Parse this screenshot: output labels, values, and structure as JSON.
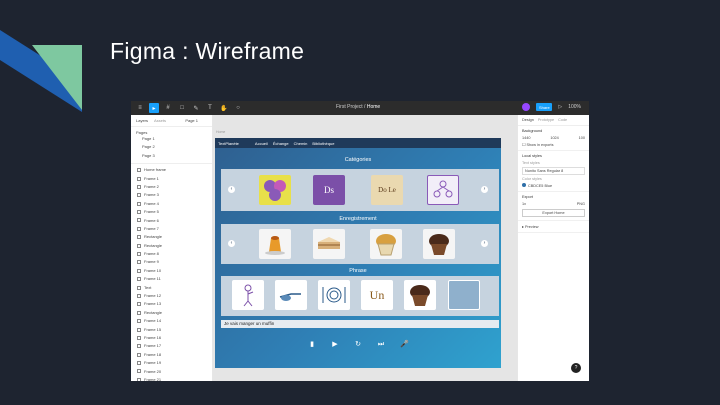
{
  "slide": {
    "title": "Figma : Wireframe",
    "accent_blue": "#1f5fb0",
    "accent_green": "#7ec8a0"
  },
  "toolbar": {
    "icons": [
      "menu-icon",
      "move-icon",
      "frame-icon",
      "shape-icon",
      "pen-icon",
      "text-icon",
      "hand-icon",
      "comment-icon"
    ],
    "project": "First Project",
    "separator": " / ",
    "file": "Home",
    "share_label": "Share",
    "play_icon": "play-icon",
    "zoom": "100%"
  },
  "left_panel": {
    "tabs": [
      "Layers",
      "Assets"
    ],
    "page_indicator": "Page 1",
    "pages_header": "Pages",
    "pages": [
      "Page 1",
      "Page 2",
      "Page 3"
    ],
    "layers": [
      "Home frame",
      "Frame 1",
      "Frame 2",
      "Frame 3",
      "Frame 4",
      "Frame 5",
      "Frame 6",
      "Frame 7",
      "Rectangle",
      "Rectangle",
      "Frame 8",
      "Frame 9",
      "Frame 10",
      "Frame 11",
      "Text",
      "Frame 12",
      "Frame 13",
      "Rectangle",
      "Frame 14",
      "Frame 15",
      "Frame 16",
      "Frame 17",
      "Frame 18",
      "Frame 19",
      "Frame 20",
      "Frame 21",
      "Frame 22",
      "Frame 23"
    ]
  },
  "canvas": {
    "frame_label": "Home",
    "navbar": {
      "brand": "TextPlanète",
      "items": [
        "Accueil",
        "Échange",
        "Chemin",
        "Bibliothèque"
      ]
    },
    "sections": [
      {
        "title": "Catégories",
        "tiles": [
          {
            "icon": "people-group-icon",
            "label": ""
          },
          {
            "icon": "ds-card-icon",
            "label": "Ds"
          },
          {
            "icon": "donne-card-icon",
            "label": "Do Le"
          },
          {
            "icon": "family-icon",
            "label": ""
          }
        ]
      },
      {
        "title": "Enregistrement",
        "tiles": [
          {
            "icon": "pudding-icon",
            "label": ""
          },
          {
            "icon": "cake-icon",
            "label": ""
          },
          {
            "icon": "muffin-icon",
            "label": ""
          },
          {
            "icon": "chocolate-muffin-icon",
            "label": ""
          }
        ]
      },
      {
        "title": "Phrase",
        "tiles": [
          {
            "icon": "person-pointing-icon",
            "label": ""
          },
          {
            "icon": "hand-pointing-icon",
            "label": ""
          },
          {
            "icon": "plate-cutlery-icon",
            "label": ""
          },
          {
            "icon": "un-word-icon",
            "label": "Un"
          },
          {
            "icon": "chocolate-muffin-icon",
            "label": ""
          },
          {
            "icon": "empty-slot-icon",
            "label": ""
          }
        ]
      }
    ],
    "sentence": "Je vais manger un muffin",
    "controls": [
      "delete-icon",
      "play-icon",
      "refresh-icon",
      "next-icon",
      "microphone-icon"
    ]
  },
  "right_panel": {
    "tabs": [
      "Design",
      "Prototype",
      "Code"
    ],
    "background": {
      "title": "Background",
      "values": [
        "1440",
        "1024",
        "100"
      ],
      "toggle": "Show in exports"
    },
    "local": {
      "title": "Local styles",
      "field_label": "Text styles",
      "field_value": "Nunito Sans Regular 8",
      "color_label": "Color styles",
      "color_value": "CBDCE5 Blue"
    },
    "export": {
      "title": "Export",
      "values": [
        "1x",
        "PNG"
      ],
      "button": "Export Home"
    },
    "more": "Preview"
  }
}
